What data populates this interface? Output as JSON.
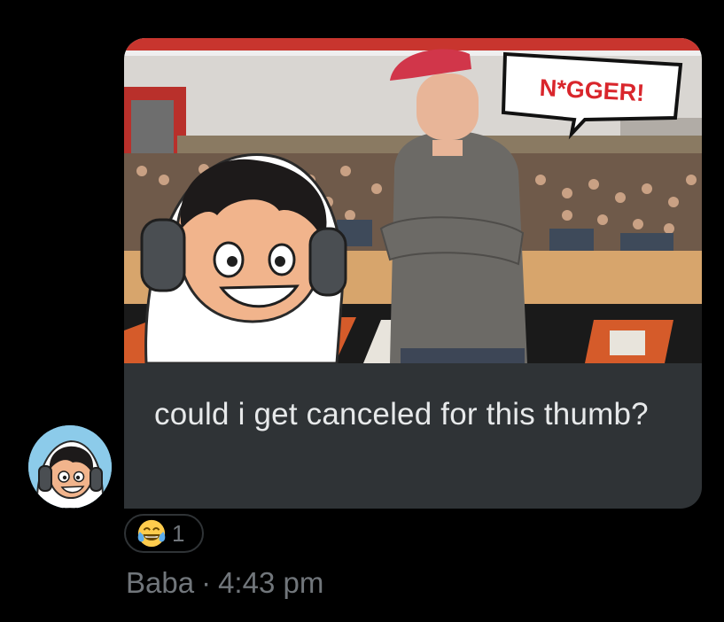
{
  "message": {
    "text": "could i get canceled for this thumb?",
    "thumbnail": {
      "speech_bubble_text": "N*GGER!"
    }
  },
  "reaction": {
    "emoji": "face-with-tears-of-joy",
    "count": "1"
  },
  "meta": {
    "sender": "Baba",
    "separator": "·",
    "time": "4:43 pm"
  },
  "colors": {
    "background": "#000000",
    "bubble": "#2f3336",
    "text": "#e7e9ea",
    "muted": "#71767b"
  }
}
